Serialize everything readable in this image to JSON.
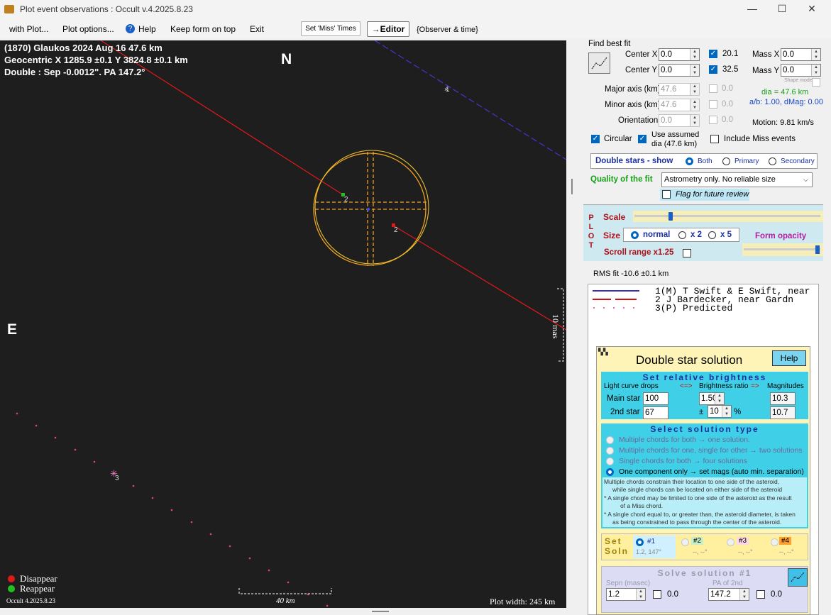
{
  "window": {
    "title": "Plot event observations : Occult v.4.2025.8.23",
    "min": "—",
    "max": "☐",
    "close": "✕"
  },
  "menu": {
    "items": [
      "with Plot...",
      "Plot options...",
      "Help",
      "Keep form on top",
      "Exit"
    ],
    "set_miss": "Set 'Miss' Times",
    "editor": "→Editor",
    "observer": "{Observer & time}"
  },
  "plot": {
    "line1": "(1870) Glaukos  2024 Aug 16  47.6 km",
    "line2": "Geocentric X  1285.9 ±0.1  Y 3824.8 ±0.1 km",
    "line3": "Double : Sep  -0.0012\". PA 147.2°",
    "north": "N",
    "east": "E",
    "scale_vert": "10 mas",
    "scale_horiz": "40 km",
    "legend_disappear": "Disappear",
    "legend_reappear": "Reappear",
    "version": "Occult 4.2025.8.23",
    "width_label": "Plot width: 245 km",
    "chord_labels": [
      "1",
      "2",
      "2",
      "3"
    ]
  },
  "fit": {
    "title": "Find best fit",
    "center_x_label": "Center X",
    "center_x": "0.0",
    "center_y_label": "Center Y",
    "center_y": "0.0",
    "val_201": "20.1",
    "val_325": "32.5",
    "mass_x_label": "Mass X",
    "mass_x": "0.0",
    "mass_y_label": "Mass Y",
    "mass_y": "0.0",
    "shape_model": "Shape model",
    "major_label": "Major axis (km)",
    "major": "47.6",
    "major_uc": "0.0",
    "minor_label": "Minor axis (km)",
    "minor": "47.6",
    "minor_uc": "0.0",
    "orient_label": "Orientation",
    "orient": "0.0",
    "orient_uc": "0.0",
    "dia": "dia = 47.6 km",
    "ab": "a/b: 1.00, dMag: 0.00",
    "motion": "Motion: 9.81 km/s",
    "circular": "Circular",
    "use_assumed": "Use assumed",
    "use_assumed2": "dia (47.6 km)",
    "include_miss": "Include Miss events"
  },
  "double": {
    "label": "Double stars - show",
    "both": "Both",
    "primary": "Primary",
    "secondary": "Secondary"
  },
  "quality": {
    "label": "Quality of the fit",
    "value": "Astrometry only. No reliable size",
    "flag": "Flag for future review"
  },
  "plotpanel": {
    "letters": [
      "P",
      "L",
      "O",
      "T"
    ],
    "scale": "Scale",
    "size": "Size",
    "normal": "normal",
    "x2": "x 2",
    "x5": "x 5",
    "opacity": "Form opacity",
    "scroll": "Scroll range x1.25"
  },
  "rms": "RMS fit -10.6 ±0.1 km",
  "legend": [
    {
      "idx": "1(M)",
      "name": "T Swift & E Swift, near",
      "color": "#3a2fb8"
    },
    {
      "idx": "2",
      "name": "J Bardecker, near Gardn",
      "color": "#d01010"
    },
    {
      "idx": "3(P)",
      "name": "Predicted",
      "color": "#e040a0"
    }
  ],
  "ds": {
    "title": "Double star solution",
    "help": "Help",
    "brightness_title": "Set  relative  brightness",
    "col1": "Light curve drops",
    "arrow1": "<=>",
    "col2": "Brightness ratio",
    "arrow2": "=>",
    "col3": "Magnitudes",
    "main_label": "Main star",
    "main_drop": "100",
    "ratio": "1.50",
    "main_mag": "10.3",
    "second_label": "2nd star",
    "second_drop": "67",
    "pm": "±",
    "pct": "10",
    "pct_sym": "%",
    "second_mag": "10.7",
    "type_title": "Select  solution  type",
    "opt1": "Multiple chords for both → one solution.",
    "opt2": "Multiple chords for one, single for other → two solutions",
    "opt3": "Single chords for both → four solutions",
    "opt4": "One component only → set mags (auto min. separation)",
    "note1": "Multiple chords constrain their location to one side of the asteroid,",
    "note2": "while single chords can be located on either side of the asteroid",
    "note3": "* A single chord may be limited to one side of the asteroid as the result",
    "note4": "of a Miss chord.",
    "note5": "* A single chord equal to, or greater than, the asteroid diameter, is taken",
    "note6": "as being constrained to pass through the center of the asteroid.",
    "set": "Set",
    "soln": "Soln",
    "s1": "#1",
    "s1v": "1.2, 147°",
    "s2": "#2",
    "s2v": "--, --°",
    "s3": "#3",
    "s3v": "--, --°",
    "s4": "#4",
    "s4v": "--, --°",
    "solve_title": "Solve  solution  #1",
    "sepn_label": "Sepn (masec)",
    "sepn": "1.2",
    "sepn_uc": "0.0",
    "pa_label": "PA of 2nd",
    "pa": "147.2",
    "pa_uc": "0.0"
  }
}
